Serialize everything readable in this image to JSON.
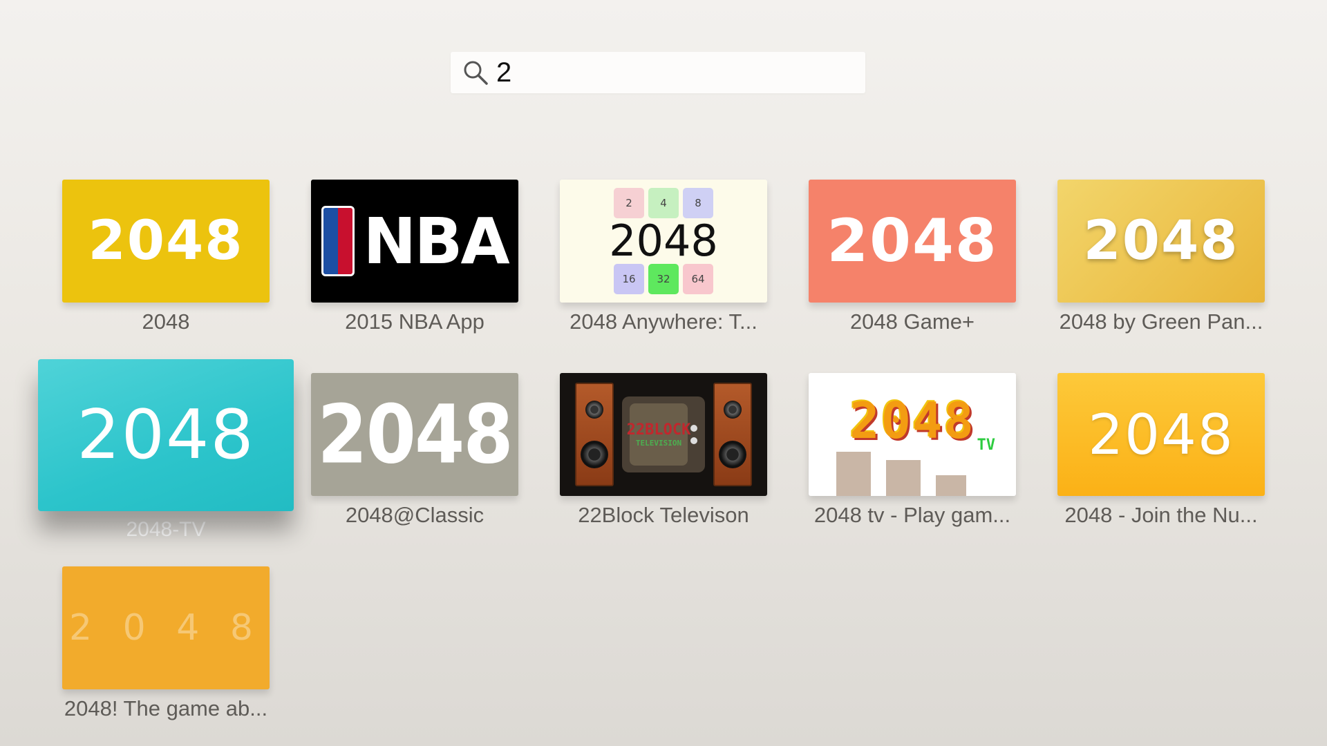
{
  "search": {
    "query": "2",
    "icon": "magnifier-icon"
  },
  "results": [
    {
      "title": "2048",
      "art_text": "2048",
      "art_color": "#ecc30e"
    },
    {
      "title": "2015 NBA App",
      "art_text": "NBA",
      "art_color": "#000000"
    },
    {
      "title": "2048 Anywhere: T...",
      "art_text": "2048",
      "art_cells_top": [
        "2",
        "4",
        "8"
      ],
      "art_cells_bottom": [
        "16",
        "32",
        "64"
      ],
      "art_color": "#fdfbea"
    },
    {
      "title": "2048 Game+",
      "art_text": "2048",
      "art_color": "#f5826a"
    },
    {
      "title": "2048 by Green Pan...",
      "art_text": "2048",
      "art_color": "#e9b639"
    },
    {
      "title": "2048-TV",
      "art_text": "2048",
      "art_color": "#2cc4cb",
      "focused": true
    },
    {
      "title": "2048@Classic",
      "art_text": "2048",
      "art_color": "#a6a497"
    },
    {
      "title": "22Block Televison",
      "art_text_1": "22BLOCK",
      "art_text_2": "TELEVISION",
      "art_color": "#151210"
    },
    {
      "title": "2048 tv - Play gam...",
      "art_text": "2048",
      "art_badge": "TV",
      "art_color": "#ffffff"
    },
    {
      "title": "2048 - Join the Nu...",
      "art_text": "2048",
      "art_color": "#fbb116"
    },
    {
      "title": "2048! The game ab...",
      "art_text": "2 0 4 8",
      "art_color": "#f2ab2c"
    }
  ]
}
